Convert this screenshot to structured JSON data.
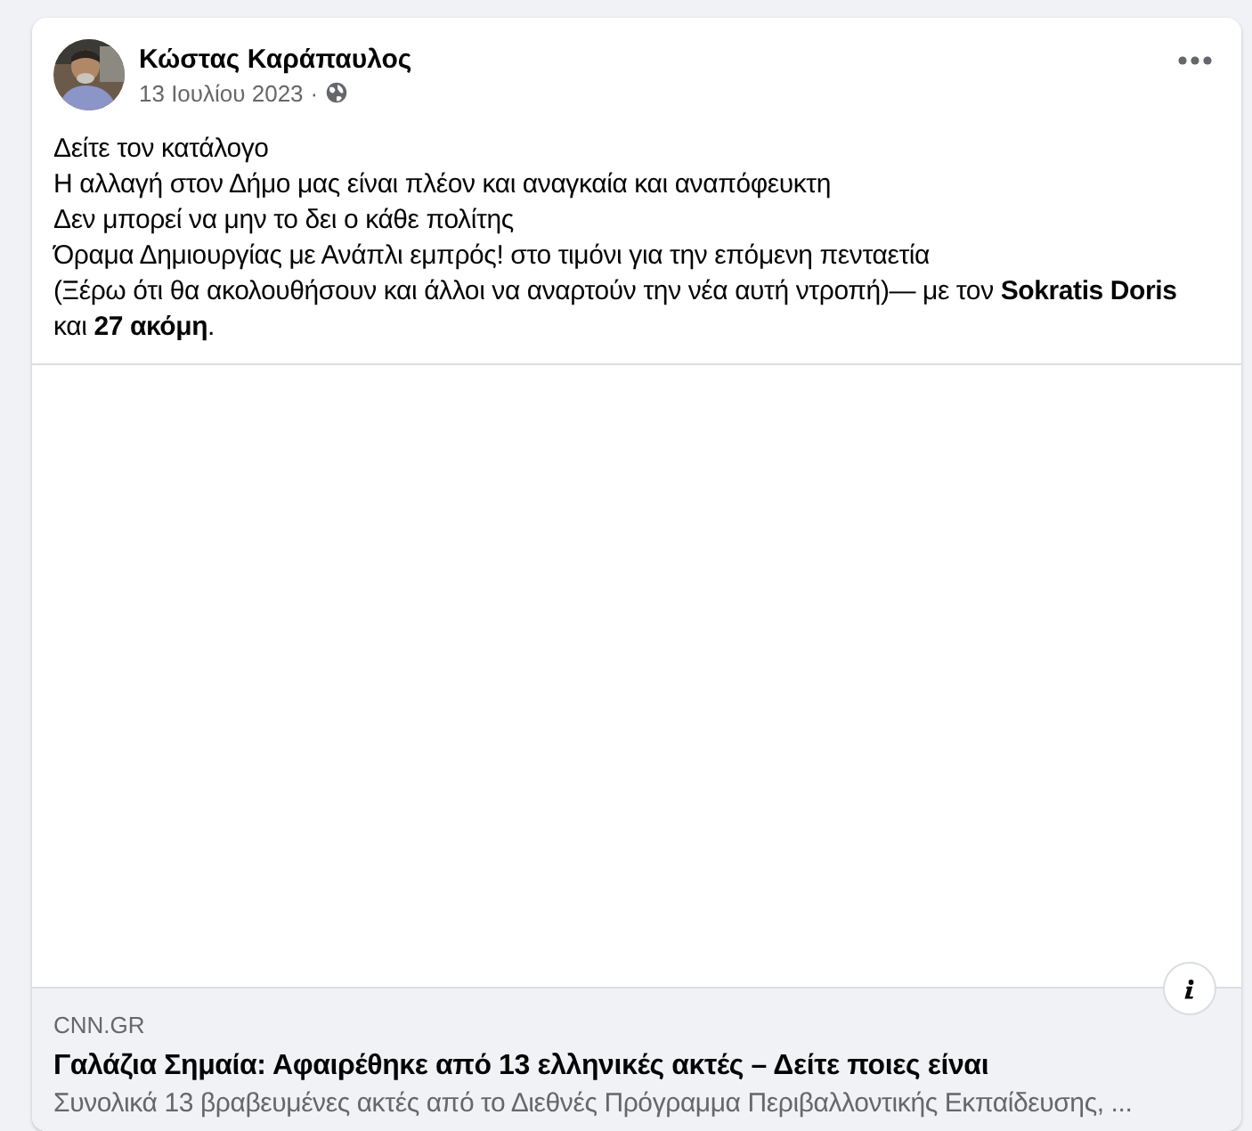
{
  "post": {
    "author": "Κώστας Καράπαυλος",
    "date": "13 Ιουλίου 2023",
    "separator": "·",
    "lines": [
      "Δείτε τον κατάλογο",
      "Η αλλαγή στον Δήμο μας είναι πλέον και αναγκαία και αναπόφευκτη",
      "Δεν μπορεί να μην το δει ο κάθε πολίτης",
      "Όραμα Δημιουργίας με Ανάπλι εμπρός! στο τιμόνι για την επόμενη πενταετία",
      "(Ξέρω ότι θα ακολουθήσουν και άλλοι να αναρτούν την νέα αυτή ντροπή)— με τον **Sokratis Doris** και **27 ακόμη**."
    ]
  },
  "link": {
    "domain": "CNN.GR",
    "title": "Γαλάζια Σημαία: Αφαιρέθηκε από 13 ελληνικές ακτές – Δείτε ποιες είναι",
    "description": "Συνολικά 13 βραβευμένες ακτές από το Διεθνές Πρόγραμμα Περιβαλλοντικής Εκπαίδευσης, ..."
  }
}
